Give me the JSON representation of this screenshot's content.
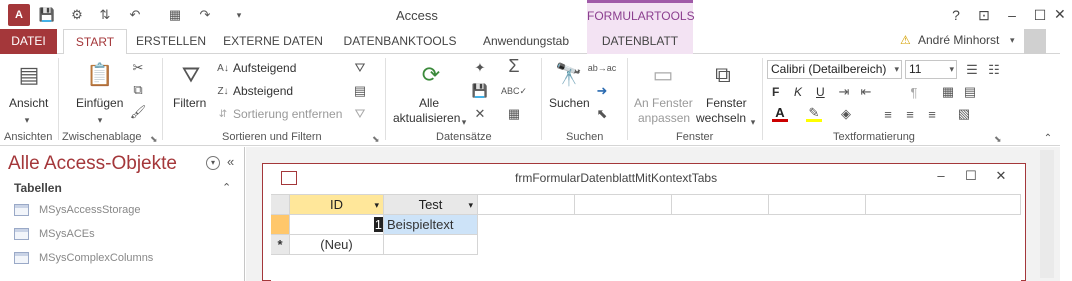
{
  "app": {
    "logo_text": "A",
    "title": "Access",
    "tool_header": "FORMULARTOOLS",
    "user_name": "André Minhorst",
    "help": "?"
  },
  "tabs": [
    "DATEI",
    "START",
    "ERSTELLEN",
    "EXTERNE DATEN",
    "DATENBANKTOOLS",
    "Anwendungstab",
    "DATENBLATT"
  ],
  "ribbon": {
    "ansicht": "Ansicht",
    "einfuegen": "Einfügen",
    "filtern": "Filtern",
    "aufsteigend": "Aufsteigend",
    "absteigend": "Absteigend",
    "sortierung_entfernen": "Sortierung entfernen",
    "alle": "Alle",
    "aktualisieren": "aktualisieren",
    "suchen": "Suchen",
    "an_fenster": "An Fenster",
    "anpassen": "anpassen",
    "fenster": "Fenster",
    "wechseln": "wechseln",
    "font_name": "Calibri (Detailbereich)",
    "font_size": "11",
    "bold": "F",
    "italic": "K",
    "underline": "U",
    "groups": {
      "ansichten": "Ansichten",
      "zwischenablage": "Zwischenablage",
      "sortieren": "Sortieren und Filtern",
      "datensaetze": "Datensätze",
      "suchen": "Suchen",
      "fenster": "Fenster",
      "textformatierung": "Textformatierung"
    }
  },
  "nav": {
    "title": "Alle Access-Objekte",
    "section": "Tabellen",
    "items": [
      "MSysAccessStorage",
      "MSysACEs",
      "MSysComplexColumns"
    ]
  },
  "form": {
    "caption": "frmFormularDatenblattMitKontextTabs",
    "columns": [
      "ID",
      "Test"
    ],
    "rows": [
      {
        "id": "1",
        "test": "Beispieltext"
      }
    ],
    "new_row_marker": "*",
    "new_row_label": "(Neu)"
  },
  "colors": {
    "accent": "#a4373a",
    "tool": "#a05aa8"
  }
}
